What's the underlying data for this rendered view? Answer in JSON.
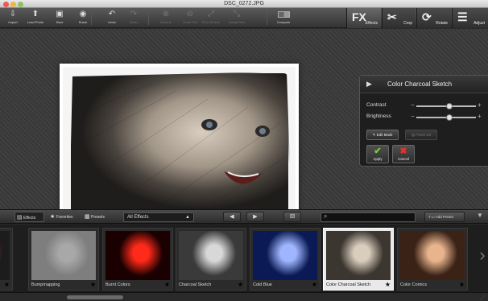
{
  "window": {
    "title": "DSC_0272.JPG"
  },
  "toolbar": {
    "buttons": [
      {
        "label": "Import",
        "icon": "import-icon",
        "glyph": "⇩",
        "enabled": true
      },
      {
        "label": "Load Photo",
        "icon": "load-photo-icon",
        "glyph": "⬆",
        "enabled": true
      },
      {
        "label": "Save",
        "icon": "save-icon",
        "glyph": "▣",
        "enabled": true
      },
      {
        "label": "Share",
        "icon": "share-icon",
        "glyph": "◉",
        "enabled": true
      },
      {
        "label": "Undo",
        "icon": "undo-icon",
        "glyph": "↶",
        "enabled": true
      },
      {
        "label": "Redo",
        "icon": "redo-icon",
        "glyph": "↷",
        "enabled": false
      },
      {
        "label": "Zoom In",
        "icon": "zoom-in-icon",
        "glyph": "⊕",
        "enabled": false
      },
      {
        "label": "Zoom Out",
        "icon": "zoom-out-icon",
        "glyph": "⊖",
        "enabled": false
      },
      {
        "label": "Fit to Screen",
        "icon": "fit-to-screen-icon",
        "glyph": "⤢",
        "enabled": false
      },
      {
        "label": "Actual Size",
        "icon": "actual-size-icon",
        "glyph": "⤡",
        "enabled": false
      }
    ],
    "compare_label": "Compare"
  },
  "modes": [
    {
      "label": "Effects",
      "glyph": "FX",
      "icon": "fx-icon",
      "active": true
    },
    {
      "label": "Crop",
      "glyph": "✂",
      "icon": "crop-icon",
      "active": false
    },
    {
      "label": "Rotate",
      "glyph": "⟳",
      "icon": "rotate-icon",
      "active": false
    },
    {
      "label": "Adjust",
      "glyph": "☰",
      "icon": "adjust-icon",
      "active": false
    }
  ],
  "panel": {
    "title": "Color Charcoal Sketch",
    "sliders": [
      {
        "label": "Contrast",
        "level": 0.55
      },
      {
        "label": "Brightness",
        "level": 0.55
      }
    ],
    "edit_mask_label": "Edit Mask",
    "finish_label": "Finish Ed",
    "apply_label": "Apply",
    "cancel_label": "Cancel"
  },
  "bottom": {
    "tabs": [
      {
        "label": "Effects",
        "icon": "effects-tab-icon",
        "glyph": "▤"
      },
      {
        "label": "Favorites",
        "icon": "star-icon",
        "glyph": "★"
      },
      {
        "label": "Presets",
        "icon": "presets-icon",
        "glyph": "▦"
      }
    ],
    "category": "All Effects",
    "add_preset_label": "Add Preset",
    "search_placeholder": ""
  },
  "thumbnails": [
    {
      "label": "",
      "colors": [
        "#9a3a2a",
        "#1c1c1c"
      ],
      "selected": false
    },
    {
      "label": "Bumpmapping",
      "colors": [
        "#a8a8a8",
        "#7e7e7e"
      ],
      "selected": false
    },
    {
      "label": "Burnt Colors",
      "colors": [
        "#ff2a1a",
        "#1a0000"
      ],
      "selected": false
    },
    {
      "label": "Charcoal Sketch",
      "colors": [
        "#d8d8d8",
        "#3a3a3a"
      ],
      "selected": false
    },
    {
      "label": "Cold Blue",
      "colors": [
        "#9fb6ff",
        "#0b1a55"
      ],
      "selected": false
    },
    {
      "label": "Color Charcoal Sketch",
      "colors": [
        "#d9cdbd",
        "#3b3630"
      ],
      "selected": true
    },
    {
      "label": "Color Comics",
      "colors": [
        "#e8b48e",
        "#3a2216"
      ],
      "selected": false
    }
  ]
}
